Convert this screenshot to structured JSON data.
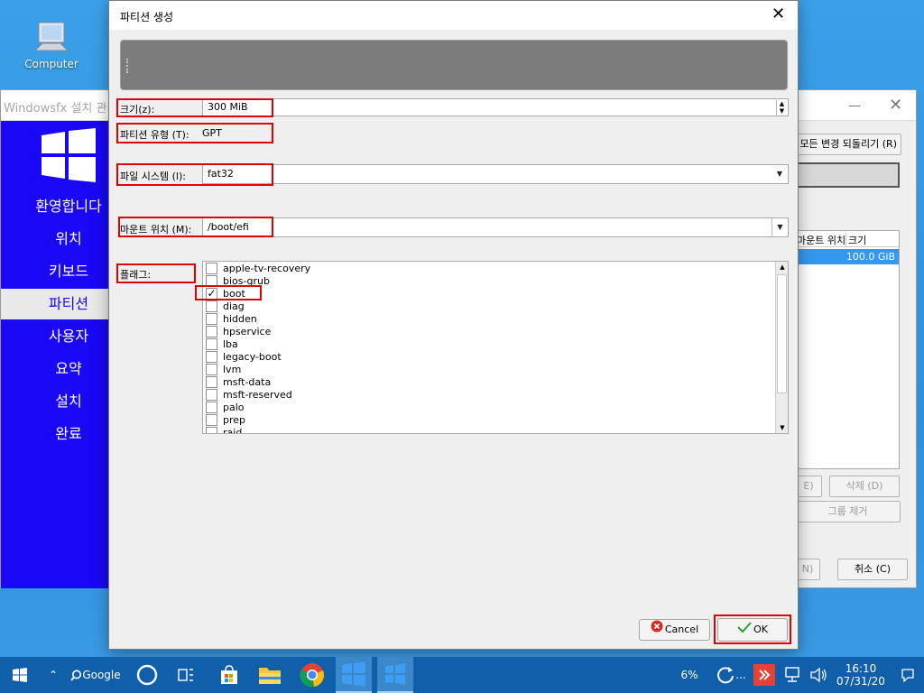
{
  "desktop": {
    "icon_label": "Computer"
  },
  "installer": {
    "title": "Windowsfx 설치 관리자",
    "nav": [
      "환영합니다",
      "위치",
      "키보드",
      "파티션",
      "사용자",
      "요약",
      "설치",
      "완료"
    ],
    "active_nav": "파티션",
    "revert_button": "모든 변경 되돌리기 (R)",
    "table_headers": [
      "마운트 위치",
      "크기"
    ],
    "table_row_size": "100.0 GiB",
    "delete_button": "삭제 (D)",
    "remove_group_button": "그룹 제거",
    "cancel_button": "취소 (C)"
  },
  "dialog": {
    "title": "파티션 생성",
    "size_label": "크기(z):",
    "size_value": "300 MiB",
    "type_label": "파티션 유형 (T):",
    "type_value": "GPT",
    "fs_label": "파일 시스템 (l):",
    "fs_value": "fat32",
    "mount_label": "마운트 위치 (M):",
    "mount_value": "/boot/efi",
    "flags_label": "플래그:",
    "flags": [
      {
        "name": "apple-tv-recovery",
        "checked": false
      },
      {
        "name": "bios-grub",
        "checked": false
      },
      {
        "name": "boot",
        "checked": true
      },
      {
        "name": "diag",
        "checked": false
      },
      {
        "name": "hidden",
        "checked": false
      },
      {
        "name": "hpservice",
        "checked": false
      },
      {
        "name": "lba",
        "checked": false
      },
      {
        "name": "legacy-boot",
        "checked": false
      },
      {
        "name": "lvm",
        "checked": false
      },
      {
        "name": "msft-data",
        "checked": false
      },
      {
        "name": "msft-reserved",
        "checked": false
      },
      {
        "name": "palo",
        "checked": false
      },
      {
        "name": "prep",
        "checked": false
      },
      {
        "name": "raid",
        "checked": false
      }
    ],
    "cancel_button": "Cancel",
    "ok_button": "OK"
  },
  "taskbar": {
    "search_label": "Google",
    "battery": "6%",
    "ellipsis": "...",
    "time": "16:10",
    "date": "07/31/20"
  },
  "colors": {
    "sidebar": "#1a07f5",
    "taskbar": "#0f5fab",
    "highlight_box": "#e00000"
  }
}
